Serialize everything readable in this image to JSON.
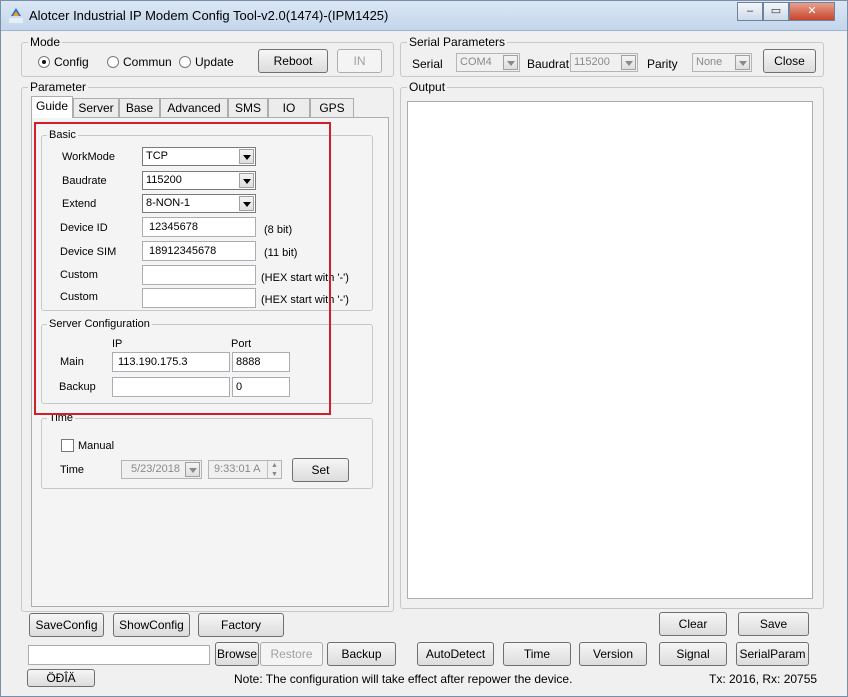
{
  "window": {
    "title": "Alotcer Industrial IP Modem Config Tool-v2.0(1474)-(IPM1425)",
    "icon_caption": "Alotcer",
    "controls": [
      "minimize-icon",
      "maximize-icon",
      "close-icon"
    ]
  },
  "mode": {
    "title": "Mode",
    "options": [
      "Config",
      "Commun",
      "Update"
    ],
    "selected": "Config",
    "reboot": "Reboot",
    "in": "IN"
  },
  "serial": {
    "title": "Serial Parameters",
    "serial_label": "Serial",
    "serial_value": "COM4",
    "baud_label": "Baudrat",
    "baud_value": "115200",
    "parity_label": "Parity",
    "parity_value": "None",
    "close": "Close"
  },
  "parameter": {
    "title": "Parameter",
    "tabs": [
      "Guide",
      "Server",
      "Base",
      "Advanced",
      "SMS",
      "IO",
      "GPS"
    ],
    "active_tab": "Guide"
  },
  "basic": {
    "title": "Basic",
    "workmode_label": "WorkMode",
    "workmode_value": "TCP",
    "baudrate_label": "Baudrate",
    "baudrate_value": "115200",
    "extend_label": "Extend",
    "extend_value": "8-NON-1",
    "device_id_label": "Device ID",
    "device_id_value": "12345678",
    "device_id_hint": "(8 bit)",
    "device_sim_label": "Device SIM",
    "device_sim_value": "18912345678",
    "device_sim_hint": "(11 bit)",
    "custom1_label": "Custom",
    "custom1_value": "",
    "custom1_hint": "(HEX start with '-')",
    "custom2_label": "Custom",
    "custom2_value": "",
    "custom2_hint": "(HEX start with '-')"
  },
  "server_config": {
    "title": "Server Configuration",
    "ip_header": "IP",
    "port_header": "Port",
    "main_label": "Main",
    "main_ip": "113.190.175.3",
    "main_port": "8888",
    "backup_label": "Backup",
    "backup_ip": "",
    "backup_port": "0"
  },
  "time": {
    "title": "Time",
    "manual_label": "Manual",
    "manual_checked": false,
    "time_label": "Time",
    "date_value": "5/23/2018",
    "time_value": "9:33:01 A",
    "set": "Set"
  },
  "output": {
    "title": "Output",
    "content": ""
  },
  "bottom": {
    "save_config": "SaveConfig",
    "show_config": "ShowConfig",
    "factory": "Factory",
    "clear": "Clear",
    "save": "Save",
    "browse_path": "",
    "browse": "Browse",
    "restore": "Restore",
    "backup": "Backup",
    "autodetect": "AutoDetect",
    "time": "Time",
    "version": "Version",
    "signal": "Signal",
    "serial_param": "SerialParam",
    "language": "ÖÐÎÄ",
    "note": "Note: The configuration will take effect after repower the device.",
    "txrx": "Tx: 2016, Rx: 20755"
  },
  "colors": {
    "highlight_box": "#d0202c"
  }
}
